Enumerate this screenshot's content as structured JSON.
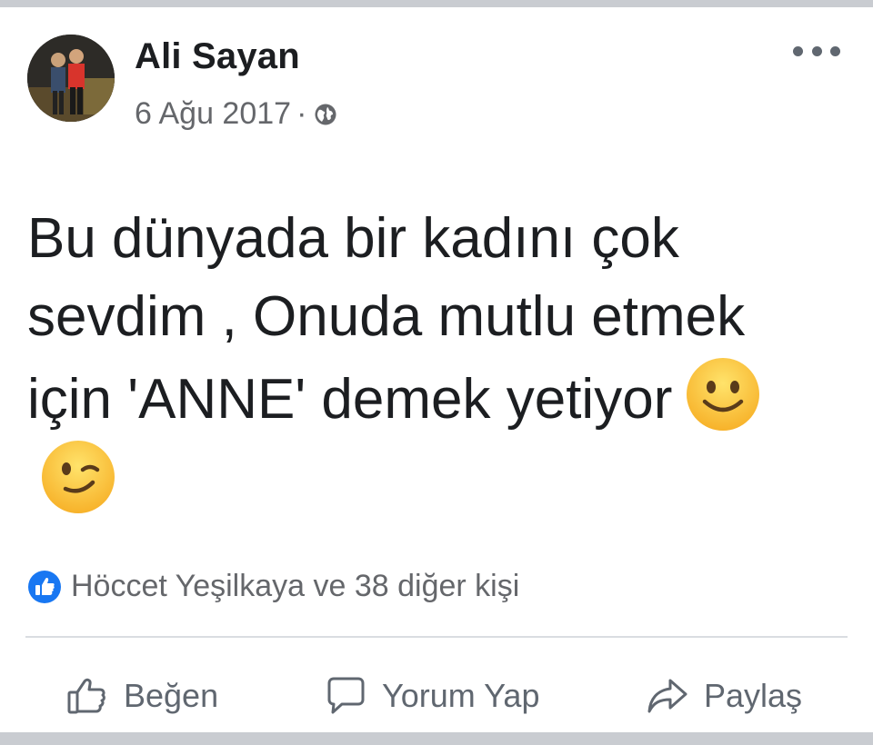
{
  "post": {
    "author": "Ali Sayan",
    "date": "6 Ağu 2017",
    "separator": "·",
    "privacy_icon": "globe-icon",
    "text": "Bu dünyada bir kadını çok sevdim , Onuda mutlu etmek için 'ANNE' demek yetiyor",
    "emojis": [
      "slightly-smiling-face",
      "winking-face"
    ]
  },
  "reactions": {
    "icon": "like-icon",
    "summary": "Höccet Yeşilkaya ve 38 diğer kişi"
  },
  "actions": {
    "like_label": "Beğen",
    "comment_label": "Yorum Yap",
    "share_label": "Paylaş"
  },
  "colors": {
    "text_primary": "#1c1e21",
    "text_secondary": "#65676b",
    "like_blue": "#1877f2",
    "emoji_yellow": "#fbbd2a"
  }
}
